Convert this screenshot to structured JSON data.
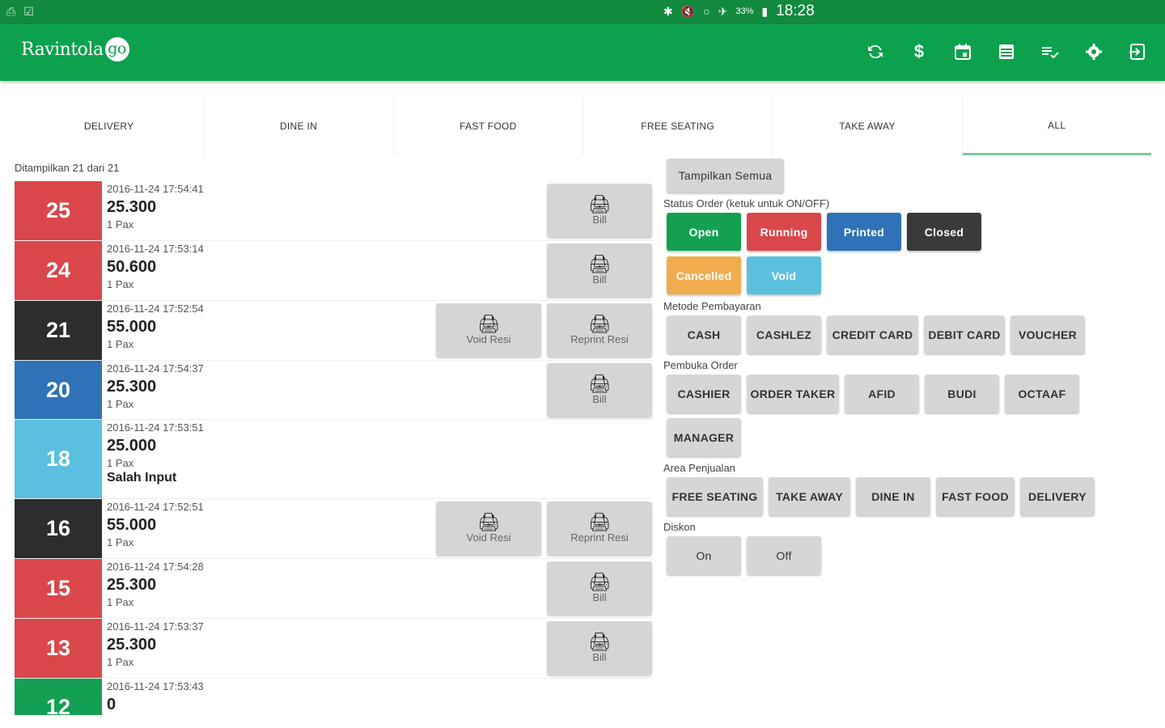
{
  "statusbar": {
    "time": "18:28",
    "battery": "33%"
  },
  "app": {
    "logo_text": "Ravintola",
    "logo_go": "go"
  },
  "toolbar_icons": [
    "refresh-icon",
    "dollar-icon",
    "calendar-icon",
    "list-icon",
    "checklist-icon",
    "gear-icon",
    "logout-icon"
  ],
  "tabs": [
    {
      "label": "DELIVERY"
    },
    {
      "label": "DINE IN"
    },
    {
      "label": "FAST FOOD"
    },
    {
      "label": "FREE SEATING"
    },
    {
      "label": "TAKE AWAY"
    },
    {
      "label": "ALL",
      "active": true
    }
  ],
  "shown_text": "Ditampilkan 21 dari 21",
  "orders": [
    {
      "num": "25",
      "color": "#d9474b",
      "ts": "2016-11-24 17:54:41",
      "amount": "25.300",
      "pax": "1 Pax",
      "buttons": [
        "Bill"
      ]
    },
    {
      "num": "24",
      "color": "#d9474b",
      "ts": "2016-11-24 17:53:14",
      "amount": "50.600",
      "pax": "1 Pax",
      "buttons": [
        "Bill"
      ]
    },
    {
      "num": "21",
      "color": "#2d2d2d",
      "ts": "2016-11-24 17:52:54",
      "amount": "55.000",
      "pax": "1 Pax",
      "buttons": [
        "Reprint Resi",
        "Void Resi"
      ]
    },
    {
      "num": "20",
      "color": "#2f72b8",
      "ts": "2016-11-24 17:54:37",
      "amount": "25.300",
      "pax": "1 Pax",
      "buttons": [
        "Bill"
      ]
    },
    {
      "num": "18",
      "color": "#5bbfe0",
      "ts": "2016-11-24 17:53:51",
      "amount": "25.000",
      "pax": "1 Pax",
      "note": "Salah Input",
      "buttons": []
    },
    {
      "num": "16",
      "color": "#2d2d2d",
      "ts": "2016-11-24 17:52:51",
      "amount": "55.000",
      "pax": "1 Pax",
      "buttons": [
        "Reprint Resi",
        "Void Resi"
      ]
    },
    {
      "num": "15",
      "color": "#d9474b",
      "ts": "2016-11-24 17:54:28",
      "amount": "25.300",
      "pax": "1 Pax",
      "buttons": [
        "Bill"
      ]
    },
    {
      "num": "13",
      "color": "#d9474b",
      "ts": "2016-11-24 17:53:37",
      "amount": "25.300",
      "pax": "1 Pax",
      "buttons": [
        "Bill"
      ]
    },
    {
      "num": "12",
      "color": "#14a052",
      "ts": "2016-11-24 17:53:43",
      "amount": "0",
      "pax": "",
      "buttons": []
    }
  ],
  "filters": {
    "show_all": "Tampilkan Semua",
    "status_title": "Status Order (ketuk untuk ON/OFF)",
    "status": [
      {
        "label": "Open",
        "color": "#14a052"
      },
      {
        "label": "Running",
        "color": "#d9474b"
      },
      {
        "label": "Printed",
        "color": "#2f72b8"
      },
      {
        "label": "Closed",
        "color": "#3a3a3a"
      },
      {
        "label": "Cancelled",
        "color": "#f0ad4e"
      },
      {
        "label": "Void",
        "color": "#5bc0de"
      }
    ],
    "payment_title": "Metode Pembayaran",
    "payment": [
      "CASH",
      "CASHLEZ",
      "CREDIT CARD",
      "DEBIT CARD",
      "VOUCHER"
    ],
    "opener_title": "Pembuka Order",
    "opener": [
      "CASHIER",
      "ORDER TAKER",
      "AFID",
      "BUDI",
      "OCTAAF",
      "MANAGER"
    ],
    "area_title": "Area Penjualan",
    "area": [
      "FREE SEATING",
      "TAKE AWAY",
      "DINE IN",
      "FAST FOOD",
      "DELIVERY"
    ],
    "discount_title": "Diskon",
    "discount": [
      "On",
      "Off"
    ]
  }
}
